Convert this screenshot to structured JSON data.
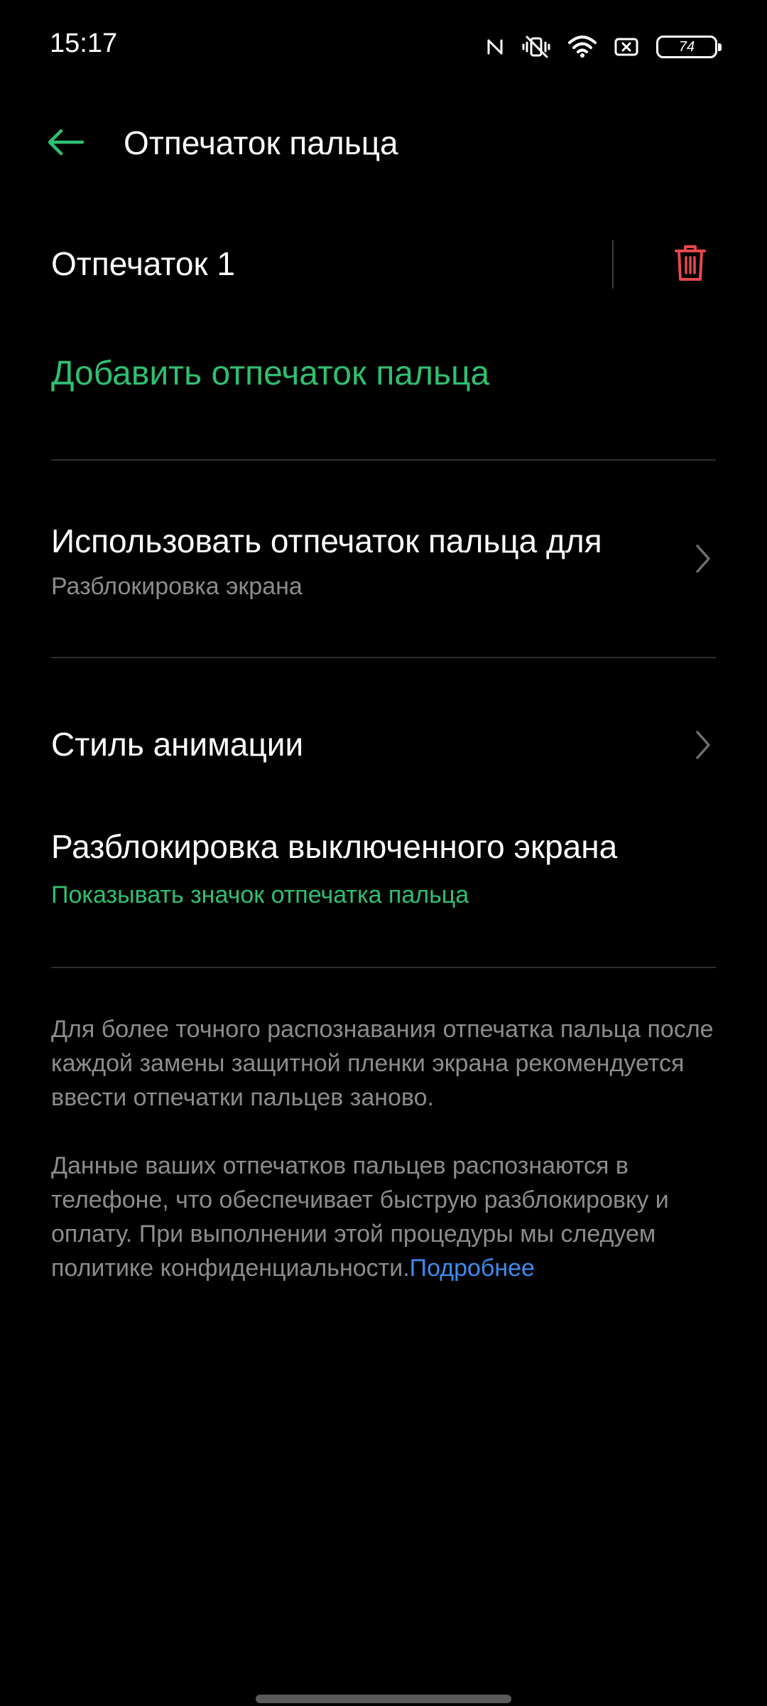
{
  "status_bar": {
    "time": "15:17",
    "battery": "74",
    "icons": [
      "nfc-icon",
      "vibrate-silent-icon",
      "wifi-icon",
      "screen-record-icon",
      "battery-icon"
    ]
  },
  "header": {
    "title": "Отпечаток пальца",
    "back_icon": "arrow-left-icon"
  },
  "fingerprint_item": {
    "label": "Отпечаток 1",
    "delete_icon": "trash-icon"
  },
  "add_fingerprint": {
    "label": "Добавить отпечаток пальца"
  },
  "menu": {
    "use_for": {
      "title": "Использовать отпечаток пальца для",
      "subtitle": "Разблокировка экрана"
    },
    "animation_style": {
      "title": "Стиль анимации"
    },
    "screen_off_unlock": {
      "title": "Разблокировка выключенного экрана",
      "subtitle": "Показывать значок отпечатка пальца"
    }
  },
  "info": {
    "paragraph1": "Для более точного распознавания отпечатка пальца после каждой замены защитной пленки экрана рекомендуется ввести отпечатки пальцев заново.",
    "paragraph2": "Данные ваших отпечатков пальцев распознаются в телефоне, что обеспечивает быструю разблокировку и оплату. При выполнении этой процедуры мы следуем политике конфиденциальности.",
    "link": "Подробнее"
  },
  "colors": {
    "background": "#000000",
    "accent_green": "#2fbf71",
    "delete_red": "#e5484d",
    "link_blue": "#3c8cf0",
    "secondary_text": "#8c8c8c"
  }
}
